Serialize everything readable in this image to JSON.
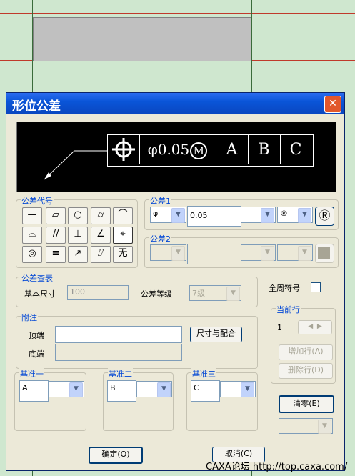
{
  "dialog": {
    "title": "形位公差",
    "close_label": "✕"
  },
  "preview": {
    "symbol": "⌖",
    "value": "φ0.05",
    "modifier": "M",
    "datums": [
      "A",
      "B",
      "C"
    ]
  },
  "symbol_group": {
    "label": "公差代号",
    "symbols": [
      "—",
      "▱",
      "○",
      "⌭",
      "⌒",
      "⌓",
      "//",
      "⊥",
      "∠",
      "⌖",
      "◎",
      "≡",
      "↗",
      "⌰",
      "无"
    ]
  },
  "tolerance1": {
    "label": "公差1",
    "prefix": "φ",
    "value": "0.05",
    "modifier_combo": "",
    "material_combo": "®",
    "reset_symbol": "Ⓡ"
  },
  "tolerance2": {
    "label": "公差2"
  },
  "lookup": {
    "label": "公差查表",
    "basic_size_label": "基本尺寸",
    "basic_size_value": "100",
    "grade_label": "公差等级",
    "grade_value": "7级"
  },
  "note": {
    "label": "附注",
    "top_label": "顶端",
    "bottom_label": "底端",
    "size_fit_button": "尺寸与配合"
  },
  "datum1": {
    "label": "基准一",
    "value": "A"
  },
  "datum2": {
    "label": "基准二",
    "value": "B"
  },
  "datum3": {
    "label": "基准三",
    "value": "C"
  },
  "all_around_label": "全周符号",
  "current_row": {
    "label": "当前行",
    "value": "1",
    "add_row": "增加行(A)",
    "delete_row": "删除行(D)"
  },
  "clear_button": "清零(E)",
  "ok_button": "确定(O)",
  "cancel_button": "取消(C)",
  "watermark": "CAXA论坛 http://top.caxa.com/"
}
